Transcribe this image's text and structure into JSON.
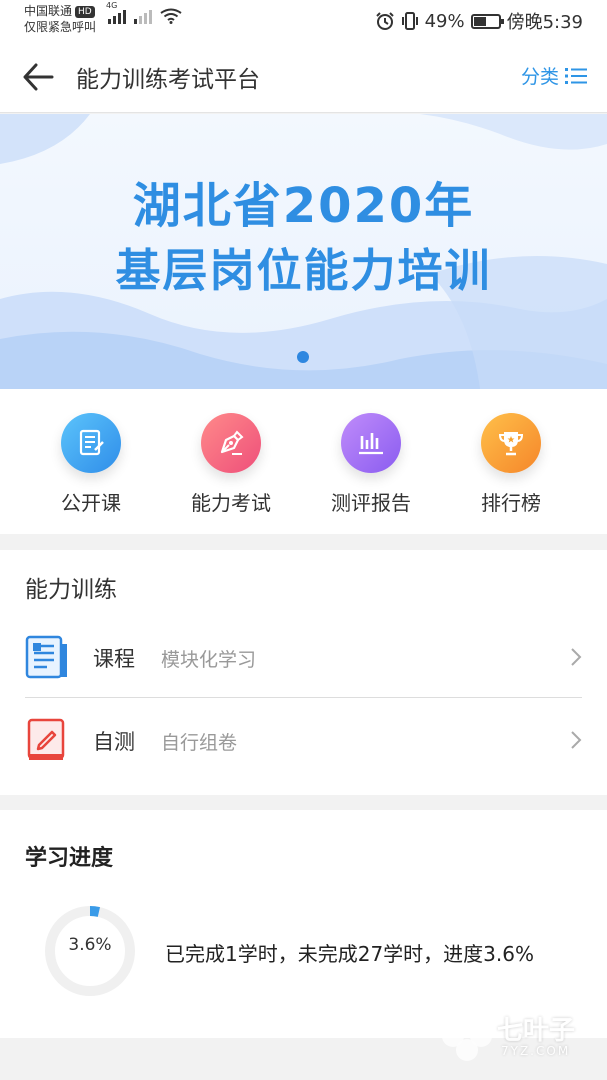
{
  "status_bar": {
    "carrier": "中国联通",
    "hd_badge": "HD",
    "emergency": "仅限紧急呼叫",
    "network_type": "4G",
    "battery_percent": "49%",
    "battery_level": 0.49,
    "time": "傍晚5:39"
  },
  "nav": {
    "title": "能力训练考试平台",
    "category_label": "分类"
  },
  "banner": {
    "line1": "湖北省2020年",
    "line2": "基层岗位能力培训",
    "text_color": "#2f8ee2"
  },
  "quick_menu": [
    {
      "label": "公开课",
      "icon": "document-edit-icon",
      "color": "#3aa4f0"
    },
    {
      "label": "能力考试",
      "icon": "pen-nib-icon",
      "color": "#f2617c"
    },
    {
      "label": "测评报告",
      "icon": "bar-chart-icon",
      "color": "#9b6cf0"
    },
    {
      "label": "排行榜",
      "icon": "trophy-icon",
      "color": "#f59a2c"
    }
  ],
  "training": {
    "title": "能力训练",
    "rows": [
      {
        "title": "课程",
        "subtitle": "模块化学习",
        "icon": "course-book-icon"
      },
      {
        "title": "自测",
        "subtitle": "自行组卷",
        "icon": "self-test-icon"
      }
    ]
  },
  "progress": {
    "title": "学习进度",
    "ring_label": "3.6%",
    "fraction": 0.036,
    "description": "已完成1学时，未完成27学时，进度3.6%"
  },
  "watermark": {
    "text": "七叶子",
    "sub": "7YZ.COM"
  }
}
